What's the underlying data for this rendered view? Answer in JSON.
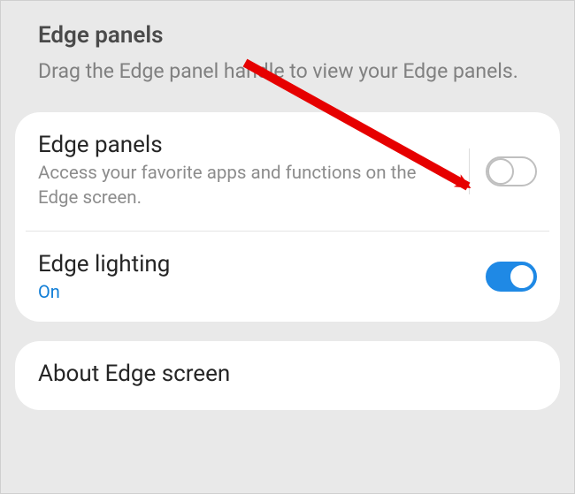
{
  "header": {
    "title": "Edge panels",
    "description": "Drag the Edge panel handle to view your Edge panels."
  },
  "settings": {
    "edge_panels": {
      "title": "Edge panels",
      "subtitle": "Access your favorite apps and functions on the Edge screen.",
      "enabled": false
    },
    "edge_lighting": {
      "title": "Edge lighting",
      "status": "On",
      "enabled": true
    }
  },
  "about": {
    "title": "About Edge screen"
  },
  "colors": {
    "accent": "#1f89e5",
    "arrow": "#e60000"
  }
}
